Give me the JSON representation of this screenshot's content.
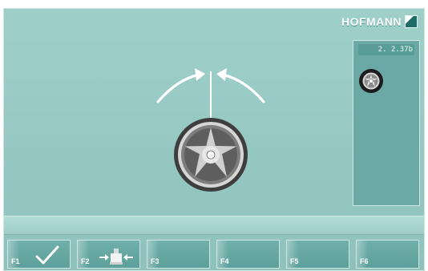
{
  "header": {
    "brand": "HOFMANN"
  },
  "right_panel": {
    "value": "2. 2.37b",
    "icon": "wheel-icon"
  },
  "main": {
    "icons": [
      "left-curved-arrow-icon",
      "right-curved-arrow-icon",
      "alloy-wheel-icon"
    ]
  },
  "function_keys": [
    {
      "label": "F1",
      "icon": "checkmark-icon"
    },
    {
      "label": "F2",
      "icon": "balancer-centering-icon"
    },
    {
      "label": "F3",
      "icon": ""
    },
    {
      "label": "F4",
      "icon": ""
    },
    {
      "label": "F5",
      "icon": ""
    },
    {
      "label": "F6",
      "icon": ""
    }
  ],
  "colors": {
    "background": "#9fcfc9",
    "panel": "#6aa9a5",
    "button": "#5d9f9a",
    "text": "#ffffff"
  }
}
